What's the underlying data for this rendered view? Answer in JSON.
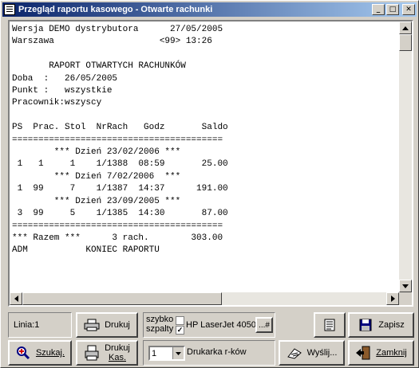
{
  "window": {
    "title": "Przegląd raportu kasowego - Otwarte rachunki",
    "minimize": "_",
    "maximize": "□",
    "close": "✕"
  },
  "report": {
    "lines": [
      "Wersja DEMO dystrybutora      27/05/2005",
      "Warszawa                    <99> 13:26",
      "",
      "       RAPORT OTWARTYCH RACHUNKÓW",
      "Doba  :   26/05/2005",
      "Punkt :   wszystkie",
      "Pracownik:wszyscy",
      "",
      "PS  Prac. Stol  NrRach   Godz       Saldo",
      "========================================",
      "        *** Dzień 23/02/2006 ***",
      " 1   1     1    1/1388  08:59       25.00",
      "        *** Dzień 7/02/2006  ***",
      " 1  99     7    1/1387  14:37      191.00",
      "        *** Dzień 23/09/2005 ***",
      " 3  99     5    1/1385  14:30       87.00",
      "========================================",
      "*** Razem ***      3 rach.        303.00",
      "ADM           KONIEC RAPORTU"
    ]
  },
  "status": {
    "line_label": "Linia:1"
  },
  "buttons": {
    "drukuj": "Drukuj",
    "drukuj_kas_1": "Drukuj",
    "drukuj_kas_2": "Kas.",
    "szukaj": "Szukaj.",
    "zapisz": "Zapisz",
    "wyslij": "Wyślij...",
    "zamknij": "Zamknij",
    "printer_select": "...#"
  },
  "options": {
    "szybko_1": "szybko",
    "szybko_2": "szpalty",
    "printer_name": "HP LaserJet 4050",
    "copies_value": "1",
    "printer_kind": "Drukarka r-ków",
    "check_mark": "✓"
  },
  "colors": {
    "title_start": "#0a246a",
    "title_end": "#a6caf0",
    "face": "#d4d0c8"
  },
  "icons": {
    "app": "report-icon",
    "drukuj": "printer-icon",
    "drukuj_kas": "receipt-printer-icon",
    "szukaj": "magnifier-icon",
    "preview": "document-icon",
    "zapisz": "floppy-disk-icon",
    "wyslij": "send-icon",
    "zamknij": "exit-door-icon"
  }
}
